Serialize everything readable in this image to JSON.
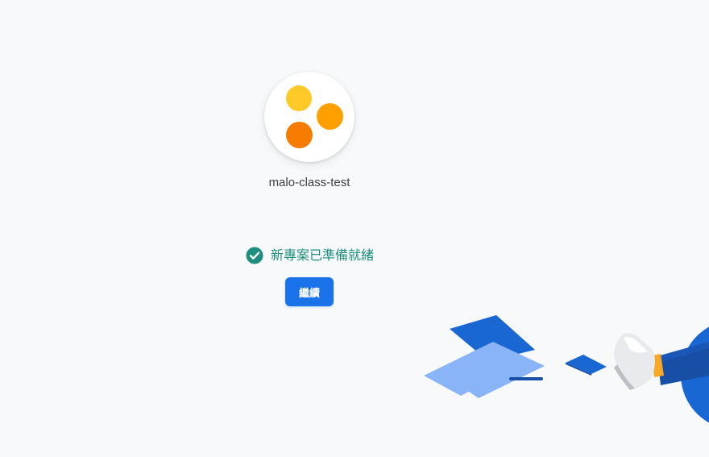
{
  "project": {
    "name": "malo-class-test",
    "avatar_colors": [
      "#ffca28",
      "#ffa000",
      "#f57c00"
    ]
  },
  "status": {
    "message": "新專案已準備就緒",
    "icon": "check-circle-icon",
    "color": "#1e8e7e"
  },
  "actions": {
    "continue_label": "繼續",
    "accent": "#1a73e8"
  },
  "illustration": {
    "icon": "relaxing-person-with-papers-illustration"
  }
}
